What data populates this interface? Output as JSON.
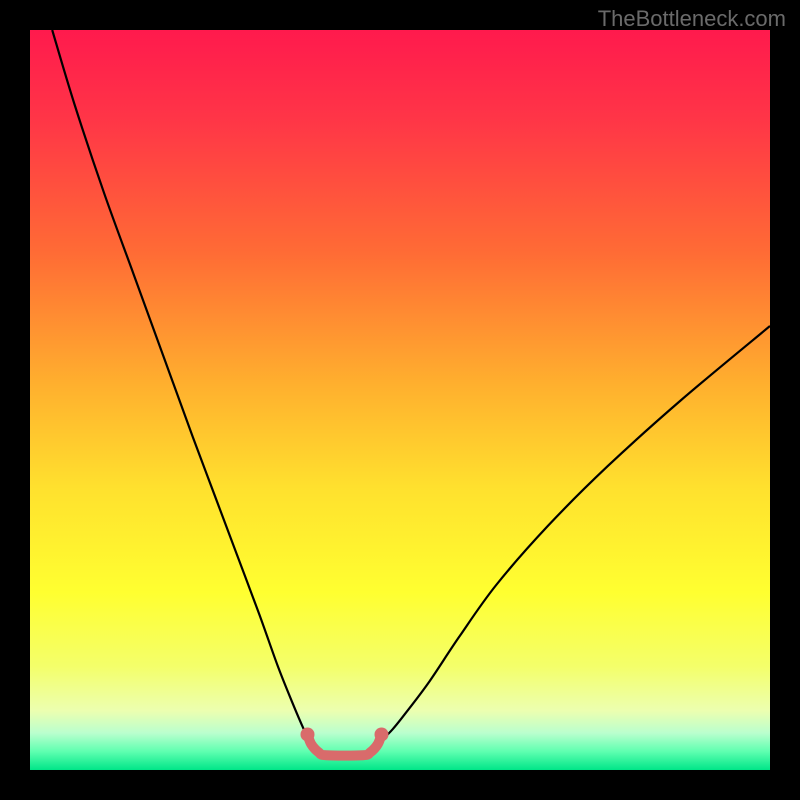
{
  "watermark": "TheBottleneck.com",
  "chart_data": {
    "type": "line",
    "title": "",
    "xlabel": "",
    "ylabel": "",
    "xlim": [
      0,
      100
    ],
    "ylim": [
      0,
      100
    ],
    "series": [
      {
        "name": "curve",
        "x": [
          3,
          6,
          10,
          14,
          18,
          22,
          25,
          28,
          31,
          33.5,
          35.5,
          37,
          38,
          39,
          40,
          45,
          46,
          47,
          49,
          51,
          54,
          58,
          63,
          70,
          78,
          88,
          100
        ],
        "y": [
          100,
          90,
          78,
          67,
          56,
          45,
          37,
          29,
          21,
          14,
          9,
          5.5,
          3.5,
          2.4,
          2,
          2,
          2.4,
          3.5,
          5.5,
          8,
          12,
          18,
          25,
          33,
          41,
          50,
          60
        ]
      },
      {
        "name": "flat-marker",
        "x": [
          37.5,
          38,
          39,
          40,
          45,
          46,
          47,
          47.5
        ],
        "y": [
          4.8,
          3.5,
          2.4,
          2,
          2,
          2.4,
          3.5,
          4.8
        ]
      }
    ],
    "marker_dots": {
      "left": {
        "x": 37.5,
        "y": 4.8
      },
      "right": {
        "x": 47.5,
        "y": 4.8
      }
    },
    "gradient_stops": [
      {
        "offset": 0.0,
        "color": "#ff1a4d"
      },
      {
        "offset": 0.12,
        "color": "#ff3547"
      },
      {
        "offset": 0.3,
        "color": "#ff6b35"
      },
      {
        "offset": 0.48,
        "color": "#ffb02e"
      },
      {
        "offset": 0.62,
        "color": "#ffe12e"
      },
      {
        "offset": 0.76,
        "color": "#ffff30"
      },
      {
        "offset": 0.86,
        "color": "#f4ff6a"
      },
      {
        "offset": 0.92,
        "color": "#ecffb0"
      },
      {
        "offset": 0.95,
        "color": "#baffce"
      },
      {
        "offset": 0.975,
        "color": "#5fffb0"
      },
      {
        "offset": 1.0,
        "color": "#00e688"
      }
    ],
    "marker_color": "#d96b6b",
    "curve_color": "#000000"
  }
}
